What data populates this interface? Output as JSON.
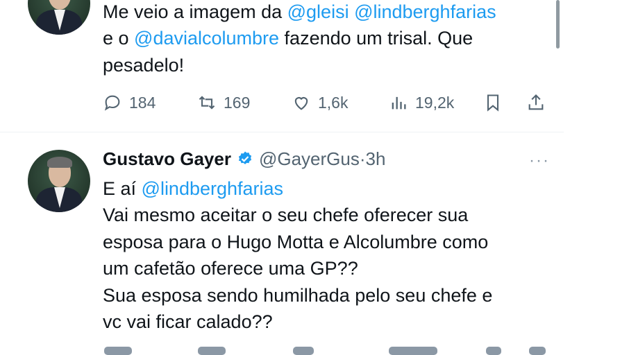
{
  "tweet1": {
    "line1_pre": "Me veio a imagem da ",
    "mention1": "@gleisi",
    "space1": " ",
    "mention2": "@lindberghfarias",
    "line2_pre": "e o ",
    "mention3": "@davialcolumbre",
    "line2_post": " fazendo um trisal. Que",
    "line3": "pesadelo!",
    "actions": {
      "reply_icon": "reply-icon",
      "reply_count": "184",
      "retweet_icon": "retweet-icon",
      "retweet_count": "169",
      "like_icon": "heart-icon",
      "like_count": "1,6k",
      "views_icon": "views-icon",
      "views_count": "19,2k",
      "bookmark_icon": "bookmark-icon",
      "share_icon": "share-icon"
    }
  },
  "tweet2": {
    "name": "Gustavo Gayer",
    "handle": "@GayerGus",
    "separator": " · ",
    "time": "3h",
    "more": "···",
    "line1_pre": "E aí ",
    "mention1": "@lindberghfarias",
    "line2": "Vai mesmo aceitar o seu chefe oferecer sua",
    "line3": "esposa para o Hugo Motta e Alcolumbre como",
    "line4": "um cafetão oferece uma GP??",
    "line5": "Sua esposa sendo humilhada pelo seu chefe e",
    "line6": "vc vai ficar calado??"
  },
  "colors": {
    "mention": "#1d9bf0",
    "text": "#0f1419",
    "muted": "#536471",
    "verified": "#1d9bf0"
  }
}
